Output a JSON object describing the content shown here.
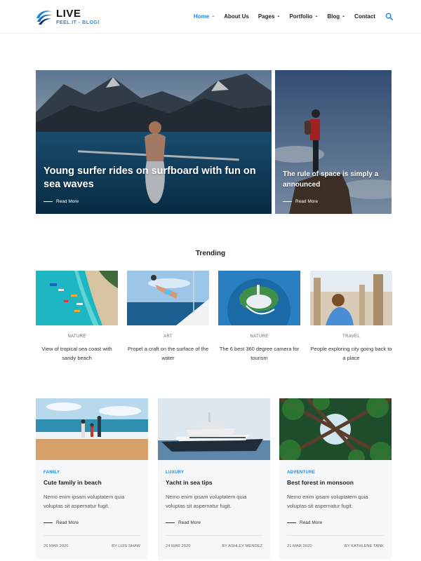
{
  "brand": {
    "title": "LIVE",
    "tagline": "FEEL IT - BLOG!",
    "accent": "#1e88e5"
  },
  "nav": {
    "items": [
      {
        "label": "Home",
        "dropdown": true,
        "active": true
      },
      {
        "label": "About Us",
        "dropdown": false
      },
      {
        "label": "Pages",
        "dropdown": true
      },
      {
        "label": "Portfolio",
        "dropdown": true
      },
      {
        "label": "Blog",
        "dropdown": true
      },
      {
        "label": "Contact",
        "dropdown": false
      }
    ],
    "search_icon": "search-icon"
  },
  "hero": [
    {
      "title": "Young surfer rides on surfboard with fun on sea waves",
      "read_more": "Read More"
    },
    {
      "title": "The rule of space is simply a announced",
      "read_more": "Read More"
    }
  ],
  "trending": {
    "heading": "Trending",
    "items": [
      {
        "category": "NATURE",
        "title": "View of tropical sea coast with sandy beach"
      },
      {
        "category": "ART",
        "title": "Propel a craft on the surface of the water"
      },
      {
        "category": "NATURE",
        "title": "The 6 best 360 degree camera for tourism"
      },
      {
        "category": "TRAVEL",
        "title": "People exploring city going back to a place"
      }
    ]
  },
  "posts": [
    {
      "category": "FAMILY",
      "title": "Cute family in beach",
      "excerpt": "Nemo enim ipsam voluptatem quia voluptas sit aspernatur fugit.",
      "read_more": "Read More",
      "date": "26 MAR 2020",
      "author": "BY LUIS SHAW"
    },
    {
      "category": "LUXURY",
      "title": "Yacht in sea tips",
      "excerpt": "Nemo enim ipsam voluptatem quia voluptas sit aspernatur fugit.",
      "read_more": "Read More",
      "date": "24 MAR 2020",
      "author": "BY ASHLEY MENDEZ"
    },
    {
      "category": "ADVENTURE",
      "title": "Best forest in monsoon",
      "excerpt": "Nemo enim ipsam voluptatem quia voluptas sit aspernatur fugit.",
      "read_more": "Read More",
      "date": "21 MAR 2020",
      "author": "BY KATHLENE TANK"
    }
  ]
}
